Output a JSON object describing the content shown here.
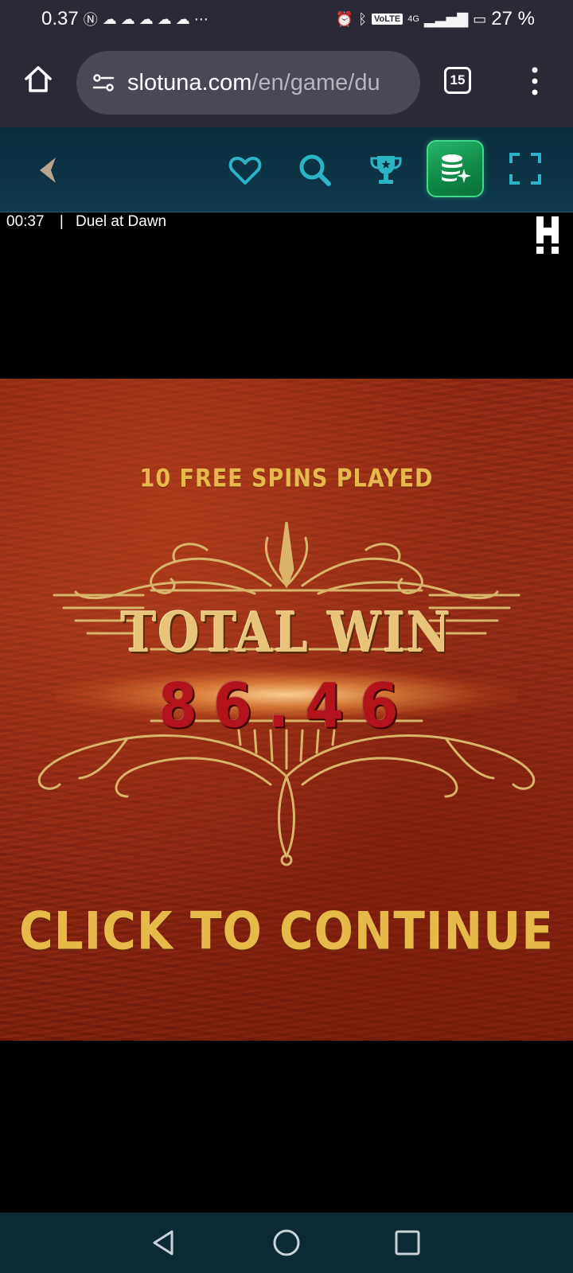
{
  "status_bar": {
    "time": "0.37",
    "battery": "27 %",
    "network": "4G",
    "volte": "VoLTE"
  },
  "browser": {
    "url_domain": "slotuna.com",
    "url_path": "/en/game/du",
    "tab_count": "15",
    "icons": [
      "home-icon",
      "site-settings-icon",
      "tab-switcher-icon",
      "more-options-icon"
    ]
  },
  "toolbar": {
    "icons": [
      "back-icon",
      "heart-icon",
      "search-icon",
      "trophy-icon",
      "wallet-icon",
      "fullscreen-icon"
    ],
    "colors": {
      "accent": "#2bb3c6",
      "wallet": "#18a057"
    }
  },
  "game": {
    "timer": "00:37",
    "separator": "|",
    "title": "Duel at Dawn"
  },
  "win_screen": {
    "free_spins": "10 FREE SPINS PLAYED",
    "total_win_label": "TOTAL WIN",
    "amount": "86.46",
    "continue": "CLICK TO CONTINUE",
    "colors": {
      "background": "#8e2611",
      "gold": "#e7c47a",
      "amount_red": "#b3141b"
    }
  },
  "nav_bar": {
    "icons": [
      "nav-back-icon",
      "nav-home-icon",
      "nav-recents-icon"
    ]
  }
}
